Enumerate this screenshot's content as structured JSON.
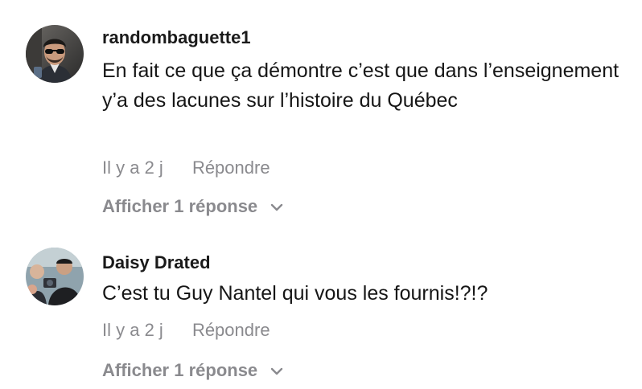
{
  "comments": [
    {
      "username": "randombaguette1",
      "text": "En fait ce que ça démontre c’est que dans l’enseignement y’a des lacunes sur l’histoire du Québec",
      "time": "Il y a 2 j",
      "reply_label": "Répondre",
      "view_replies_label": "Afficher 1 réponse",
      "avatar_icon": "user-avatar-sunglasses"
    },
    {
      "username": "Daisy Drated",
      "text": "C’est tu Guy Nantel qui vous les fournis!?!?",
      "time": "Il y a 2 j",
      "reply_label": "Répondre",
      "view_replies_label": "Afficher 1 réponse",
      "avatar_icon": "user-avatar-group-photo"
    }
  ],
  "colors": {
    "username": "#1a1a1a",
    "text": "#161616",
    "meta": "#8a8a8e"
  }
}
